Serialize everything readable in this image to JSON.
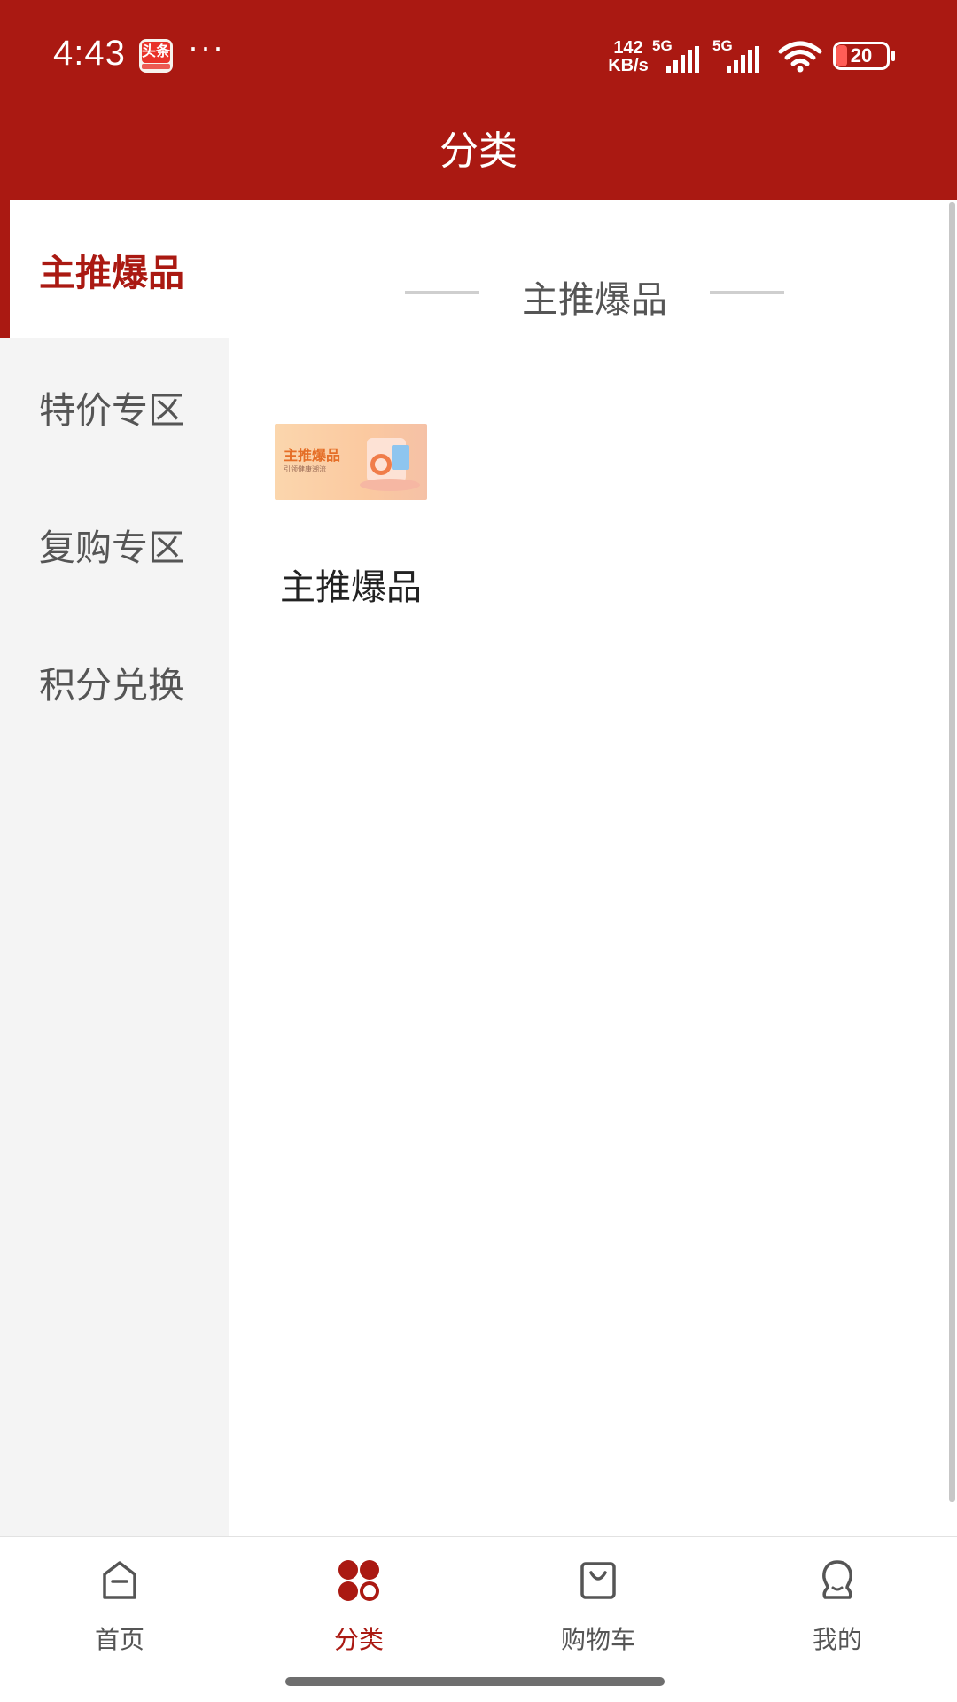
{
  "status_bar": {
    "time": "4:43",
    "app_icon_label": "头条",
    "more": "···",
    "net_speed_value": "142",
    "net_speed_unit": "KB/s",
    "signal_1_label": "5G",
    "signal_2_label": "5G",
    "battery": "20"
  },
  "header": {
    "title": "分类"
  },
  "sidebar": {
    "items": [
      {
        "label": "主推爆品",
        "active": true
      },
      {
        "label": "特价专区",
        "active": false
      },
      {
        "label": "复购专区",
        "active": false
      },
      {
        "label": "积分兑换",
        "active": false
      }
    ]
  },
  "content": {
    "section_title": "主推爆品",
    "cards": [
      {
        "label": "主推爆品",
        "image_text": "主推爆品",
        "image_subtext": "引领健康潮流"
      }
    ]
  },
  "bottom_nav": {
    "items": [
      {
        "label": "首页",
        "icon": "home-icon",
        "active": false
      },
      {
        "label": "分类",
        "icon": "category-icon",
        "active": true
      },
      {
        "label": "购物车",
        "icon": "shopping-bag-icon",
        "active": false
      },
      {
        "label": "我的",
        "icon": "profile-icon",
        "active": false
      }
    ]
  },
  "colors": {
    "brand": "#aa1912",
    "sidebar_bg": "#f4f4f4",
    "text": "#555555"
  }
}
